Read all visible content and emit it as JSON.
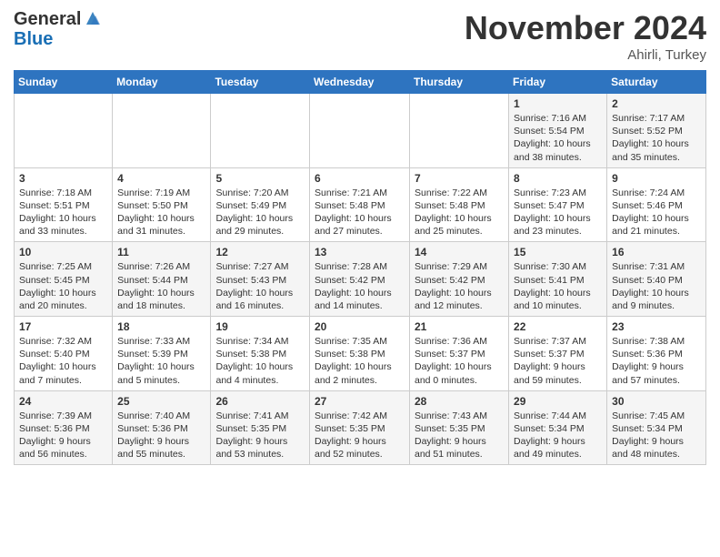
{
  "header": {
    "logo_general": "General",
    "logo_blue": "Blue",
    "month_title": "November 2024",
    "location": "Ahirli, Turkey"
  },
  "weekdays": [
    "Sunday",
    "Monday",
    "Tuesday",
    "Wednesday",
    "Thursday",
    "Friday",
    "Saturday"
  ],
  "weeks": [
    [
      {
        "day": "",
        "info": ""
      },
      {
        "day": "",
        "info": ""
      },
      {
        "day": "",
        "info": ""
      },
      {
        "day": "",
        "info": ""
      },
      {
        "day": "",
        "info": ""
      },
      {
        "day": "1",
        "info": "Sunrise: 7:16 AM\nSunset: 5:54 PM\nDaylight: 10 hours and 38 minutes."
      },
      {
        "day": "2",
        "info": "Sunrise: 7:17 AM\nSunset: 5:52 PM\nDaylight: 10 hours and 35 minutes."
      }
    ],
    [
      {
        "day": "3",
        "info": "Sunrise: 7:18 AM\nSunset: 5:51 PM\nDaylight: 10 hours and 33 minutes."
      },
      {
        "day": "4",
        "info": "Sunrise: 7:19 AM\nSunset: 5:50 PM\nDaylight: 10 hours and 31 minutes."
      },
      {
        "day": "5",
        "info": "Sunrise: 7:20 AM\nSunset: 5:49 PM\nDaylight: 10 hours and 29 minutes."
      },
      {
        "day": "6",
        "info": "Sunrise: 7:21 AM\nSunset: 5:48 PM\nDaylight: 10 hours and 27 minutes."
      },
      {
        "day": "7",
        "info": "Sunrise: 7:22 AM\nSunset: 5:48 PM\nDaylight: 10 hours and 25 minutes."
      },
      {
        "day": "8",
        "info": "Sunrise: 7:23 AM\nSunset: 5:47 PM\nDaylight: 10 hours and 23 minutes."
      },
      {
        "day": "9",
        "info": "Sunrise: 7:24 AM\nSunset: 5:46 PM\nDaylight: 10 hours and 21 minutes."
      }
    ],
    [
      {
        "day": "10",
        "info": "Sunrise: 7:25 AM\nSunset: 5:45 PM\nDaylight: 10 hours and 20 minutes."
      },
      {
        "day": "11",
        "info": "Sunrise: 7:26 AM\nSunset: 5:44 PM\nDaylight: 10 hours and 18 minutes."
      },
      {
        "day": "12",
        "info": "Sunrise: 7:27 AM\nSunset: 5:43 PM\nDaylight: 10 hours and 16 minutes."
      },
      {
        "day": "13",
        "info": "Sunrise: 7:28 AM\nSunset: 5:42 PM\nDaylight: 10 hours and 14 minutes."
      },
      {
        "day": "14",
        "info": "Sunrise: 7:29 AM\nSunset: 5:42 PM\nDaylight: 10 hours and 12 minutes."
      },
      {
        "day": "15",
        "info": "Sunrise: 7:30 AM\nSunset: 5:41 PM\nDaylight: 10 hours and 10 minutes."
      },
      {
        "day": "16",
        "info": "Sunrise: 7:31 AM\nSunset: 5:40 PM\nDaylight: 10 hours and 9 minutes."
      }
    ],
    [
      {
        "day": "17",
        "info": "Sunrise: 7:32 AM\nSunset: 5:40 PM\nDaylight: 10 hours and 7 minutes."
      },
      {
        "day": "18",
        "info": "Sunrise: 7:33 AM\nSunset: 5:39 PM\nDaylight: 10 hours and 5 minutes."
      },
      {
        "day": "19",
        "info": "Sunrise: 7:34 AM\nSunset: 5:38 PM\nDaylight: 10 hours and 4 minutes."
      },
      {
        "day": "20",
        "info": "Sunrise: 7:35 AM\nSunset: 5:38 PM\nDaylight: 10 hours and 2 minutes."
      },
      {
        "day": "21",
        "info": "Sunrise: 7:36 AM\nSunset: 5:37 PM\nDaylight: 10 hours and 0 minutes."
      },
      {
        "day": "22",
        "info": "Sunrise: 7:37 AM\nSunset: 5:37 PM\nDaylight: 9 hours and 59 minutes."
      },
      {
        "day": "23",
        "info": "Sunrise: 7:38 AM\nSunset: 5:36 PM\nDaylight: 9 hours and 57 minutes."
      }
    ],
    [
      {
        "day": "24",
        "info": "Sunrise: 7:39 AM\nSunset: 5:36 PM\nDaylight: 9 hours and 56 minutes."
      },
      {
        "day": "25",
        "info": "Sunrise: 7:40 AM\nSunset: 5:36 PM\nDaylight: 9 hours and 55 minutes."
      },
      {
        "day": "26",
        "info": "Sunrise: 7:41 AM\nSunset: 5:35 PM\nDaylight: 9 hours and 53 minutes."
      },
      {
        "day": "27",
        "info": "Sunrise: 7:42 AM\nSunset: 5:35 PM\nDaylight: 9 hours and 52 minutes."
      },
      {
        "day": "28",
        "info": "Sunrise: 7:43 AM\nSunset: 5:35 PM\nDaylight: 9 hours and 51 minutes."
      },
      {
        "day": "29",
        "info": "Sunrise: 7:44 AM\nSunset: 5:34 PM\nDaylight: 9 hours and 49 minutes."
      },
      {
        "day": "30",
        "info": "Sunrise: 7:45 AM\nSunset: 5:34 PM\nDaylight: 9 hours and 48 minutes."
      }
    ]
  ]
}
